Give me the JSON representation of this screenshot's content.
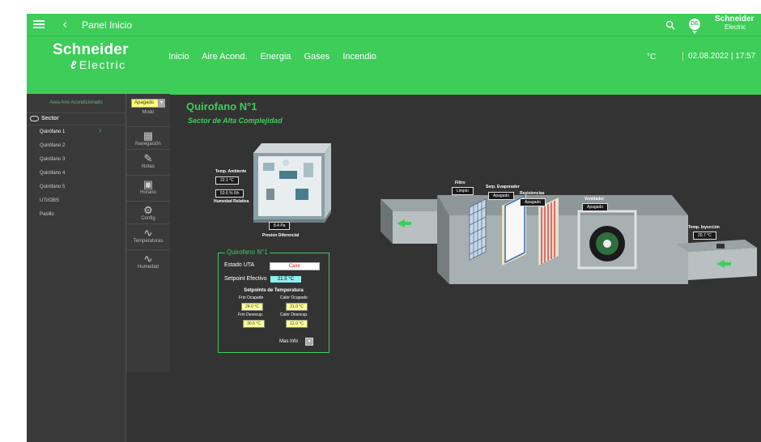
{
  "topbar": {
    "title": "Panel Inicio",
    "back": "‹",
    "avatar": "DE",
    "logo_line1": "Schneider",
    "logo_line2": "Electric"
  },
  "header": {
    "brand_line1": "Schneider",
    "brand_line2": "Electric",
    "nav": [
      "Inicio",
      "Aire Acond.",
      "Energia",
      "Gases",
      "Incendio"
    ],
    "unit": "°C",
    "datetime": "02.08.2022 | 17:57"
  },
  "sidebar": {
    "header": "Area Aire Acondicionado",
    "sector_label": "Sector",
    "items": [
      {
        "label": "Quirófano 1",
        "active": true
      },
      {
        "label": "Quirófano 2"
      },
      {
        "label": "Quirófano 3"
      },
      {
        "label": "Quirófano 4"
      },
      {
        "label": "Quirófano 5"
      },
      {
        "label": "UTI/OBS"
      },
      {
        "label": "Pasillo"
      }
    ]
  },
  "tools": {
    "mode_value": "Apagado",
    "mode_label": "Modo",
    "items": [
      {
        "label": "Navegación",
        "icon": "navigation-icon"
      },
      {
        "label": "Notas",
        "icon": "pen-icon"
      },
      {
        "label": "Horario",
        "icon": "calendar-icon"
      },
      {
        "label": "Config",
        "icon": "settings-icon"
      },
      {
        "label": "Temperaturas",
        "icon": "trend-icon"
      },
      {
        "label": "Humedad",
        "icon": "trend-icon"
      }
    ]
  },
  "main": {
    "title": "Quirofano N°1",
    "subtitle": "Sector de Alta Complejidad",
    "room": {
      "temp_label": "Temp. Ambiente",
      "temp_value": "22.1 °C",
      "humidity_value": "53.6 % Rh",
      "humidity_label": "Humedad Relativa",
      "pressure_value": "8.4 Pa",
      "pressure_label": "Presion Diferencial"
    },
    "uta": {
      "legend": "Quirofano N°1",
      "estado_label": "Estado UTA",
      "estado_value": "Calor",
      "setpoint_label": "Setpoint Efectivo",
      "setpoint_value": "21.5 °C",
      "setpoints_header": "Setpoints de Temperatura",
      "frio_ocupado_label": "Frio Ocupado",
      "frio_ocupado_value": "24.0 °C",
      "calor_ocupado_label": "Calor Ocupado",
      "calor_ocupado_value": "21.0 °C",
      "frio_desocup_label": "Frio Desocup.",
      "frio_desocup_value": "30.5 °C",
      "calor_desocup_label": "Calor Desocup.",
      "calor_desocup_value": "12.0 °C",
      "mas_info": "Mas Info"
    },
    "ahu": {
      "filtro_label": "Filtro",
      "filtro_value": "Limpio",
      "evap_label": "Serp. Evaporador",
      "evap_value": "Apagado",
      "resist_label": "Resistencias",
      "resist_value": "Apagado",
      "vent_label": "Ventilador",
      "vent_value": "Apagado",
      "iny_label": "Temp. Inyección",
      "iny_value": "20.7 °C"
    }
  },
  "colors": {
    "accent": "#3dcd58",
    "background": "#333333",
    "warning_red": "#e0221a"
  }
}
